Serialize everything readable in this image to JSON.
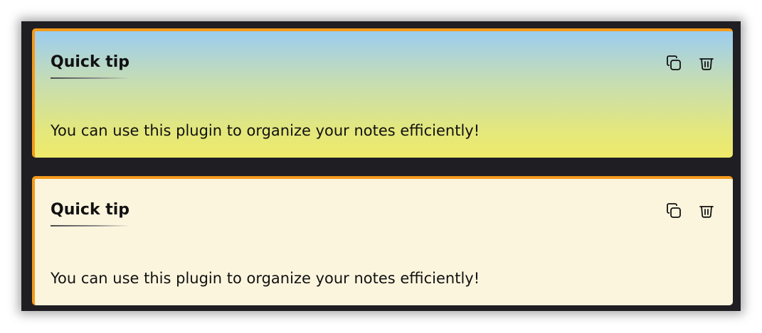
{
  "cards": [
    {
      "title": "Quick tip",
      "body": "You can use this plugin to organize your notes efficiently!",
      "style": "gradient",
      "colors": [
        "#9ccdf0",
        "#efea6a"
      ],
      "actions": [
        "copy-icon",
        "trash-icon"
      ]
    },
    {
      "title": "Quick tip",
      "body": "You can use this plugin to organize your notes efficiently!",
      "style": "cream",
      "colors": [
        "#fcf5de"
      ],
      "actions": [
        "copy-icon",
        "trash-icon"
      ]
    }
  ],
  "theme": {
    "accent": "#f39b1d",
    "panel_background": "#1f1e23"
  }
}
